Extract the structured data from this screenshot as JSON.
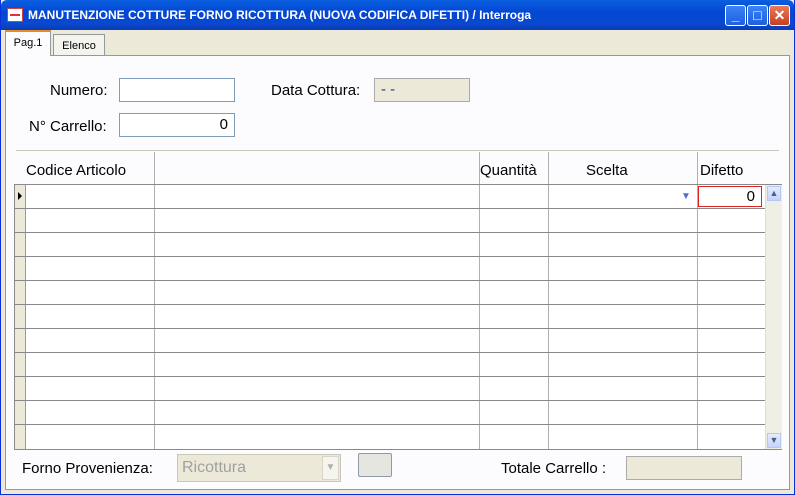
{
  "window": {
    "title": "MANUTENZIONE COTTURE FORNO RICOTTURA (NUOVA CODIFICA DIFETTI) / Interroga"
  },
  "tabs": [
    {
      "label": "Pag.1",
      "active": true
    },
    {
      "label": "Elenco",
      "active": false
    }
  ],
  "form": {
    "numero_label": "Numero:",
    "numero_value": "",
    "data_cottura_label": "Data Cottura:",
    "data_cottura_value": "- -",
    "carrello_label": "N° Carrello:",
    "carrello_value": "0"
  },
  "grid": {
    "columns": [
      "Codice Articolo",
      "",
      "Quantità",
      "Scelta",
      "Difetto"
    ],
    "first_row_difetto": "0",
    "row_count": 11
  },
  "footer": {
    "forno_label": "Forno Provenienza:",
    "forno_value": "Ricottura",
    "totale_label": "Totale Carrello :",
    "totale_value": ""
  }
}
